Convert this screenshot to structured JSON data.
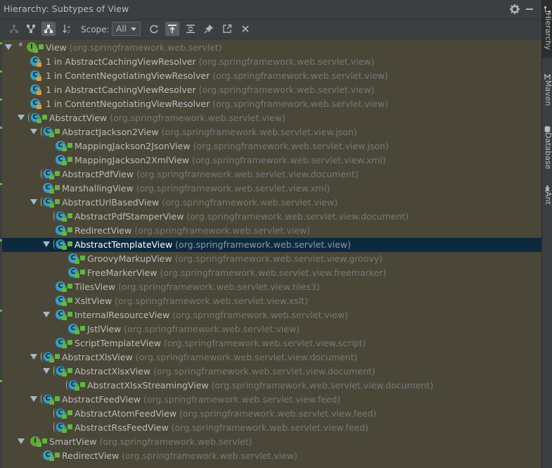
{
  "window": {
    "title": "Hierarchy:  Subtypes of View"
  },
  "toolbar": {
    "scope_label": "Scope:",
    "scope_value": "All",
    "buttons": [
      {
        "name": "supertypes-hierarchy",
        "icon": "supertypes-icon",
        "active": false
      },
      {
        "name": "subtypes-hierarchy",
        "icon": "subtypes-icon",
        "active": false
      },
      {
        "name": "class-hierarchy",
        "icon": "class-hierarchy-icon",
        "active": true
      },
      {
        "name": "sort-alphabetically",
        "icon": "sort-alpha-icon",
        "active": false
      },
      {
        "name": "refresh",
        "icon": "refresh-icon",
        "active": false
      },
      {
        "name": "autoscroll-to-source",
        "icon": "autoscroll-icon",
        "active": true
      },
      {
        "name": "expand-all",
        "icon": "expand-all-icon",
        "active": false
      },
      {
        "name": "pin",
        "icon": "pin-icon",
        "active": false
      },
      {
        "name": "export",
        "icon": "export-icon",
        "active": false
      },
      {
        "name": "close",
        "icon": "close-icon",
        "active": false
      }
    ]
  },
  "tree": [
    {
      "name": "View",
      "pkg": "(org.springframework.web.servlet)",
      "depth": 0,
      "expand": true,
      "kind": "interface",
      "star": true
    },
    {
      "name": "1 in AbstractCachingViewResolver",
      "pkg": "(org.springframework.web.servlet.view)",
      "depth": 1,
      "expand": false,
      "kind": "anon"
    },
    {
      "name": "1 in ContentNegotiatingViewResolver",
      "pkg": "(org.springframework.web.servlet.view)",
      "depth": 1,
      "expand": false,
      "kind": "anon"
    },
    {
      "name": "1 in AbstractCachingViewResolver",
      "pkg": "(org.springframework.web.servlet.view)",
      "depth": 1,
      "expand": false,
      "kind": "anon"
    },
    {
      "name": "1 in ContentNegotiatingViewResolver",
      "pkg": "(org.springframework.web.servlet.view)",
      "depth": 1,
      "expand": false,
      "kind": "anon"
    },
    {
      "name": "AbstractView",
      "pkg": "(org.springframework.web.servlet.view)",
      "depth": 1,
      "expand": true,
      "kind": "abstract"
    },
    {
      "name": "AbstractJackson2View",
      "pkg": "(org.springframework.web.servlet.view.json)",
      "depth": 2,
      "expand": true,
      "kind": "abstract"
    },
    {
      "name": "MappingJackson2JsonView",
      "pkg": "(org.springframework.web.servlet.view.json)",
      "depth": 3,
      "expand": false,
      "kind": "class"
    },
    {
      "name": "MappingJackson2XmlView",
      "pkg": "(org.springframework.web.servlet.view.xml)",
      "depth": 3,
      "expand": false,
      "kind": "class"
    },
    {
      "name": "AbstractPdfView",
      "pkg": "(org.springframework.web.servlet.view.document)",
      "depth": 2,
      "expand": false,
      "kind": "abstract"
    },
    {
      "name": "MarshallingView",
      "pkg": "(org.springframework.web.servlet.view.xml)",
      "depth": 2,
      "expand": false,
      "kind": "class"
    },
    {
      "name": "AbstractUrlBasedView",
      "pkg": "(org.springframework.web.servlet.view)",
      "depth": 2,
      "expand": true,
      "kind": "abstract"
    },
    {
      "name": "AbstractPdfStamperView",
      "pkg": "(org.springframework.web.servlet.view.document)",
      "depth": 3,
      "expand": false,
      "kind": "abstract"
    },
    {
      "name": "RedirectView",
      "pkg": "(org.springframework.web.servlet.view)",
      "depth": 3,
      "expand": false,
      "kind": "class"
    },
    {
      "name": "AbstractTemplateView",
      "pkg": "(org.springframework.web.servlet.view)",
      "depth": 3,
      "expand": true,
      "kind": "abstract",
      "selected": true
    },
    {
      "name": "GroovyMarkupView",
      "pkg": "(org.springframework.web.servlet.view.groovy)",
      "depth": 4,
      "expand": false,
      "kind": "class"
    },
    {
      "name": "FreeMarkerView",
      "pkg": "(org.springframework.web.servlet.view.freemarker)",
      "depth": 4,
      "expand": false,
      "kind": "class"
    },
    {
      "name": "TilesView",
      "pkg": "(org.springframework.web.servlet.view.tiles3)",
      "depth": 3,
      "expand": false,
      "kind": "class"
    },
    {
      "name": "XsltView",
      "pkg": "(org.springframework.web.servlet.view.xslt)",
      "depth": 3,
      "expand": false,
      "kind": "class"
    },
    {
      "name": "InternalResourceView",
      "pkg": "(org.springframework.web.servlet.view)",
      "depth": 3,
      "expand": true,
      "kind": "class"
    },
    {
      "name": "JstlView",
      "pkg": "(org.springframework.web.servlet.view)",
      "depth": 4,
      "expand": false,
      "kind": "class"
    },
    {
      "name": "ScriptTemplateView",
      "pkg": "(org.springframework.web.servlet.view.script)",
      "depth": 3,
      "expand": false,
      "kind": "class"
    },
    {
      "name": "AbstractXlsView",
      "pkg": "(org.springframework.web.servlet.view.document)",
      "depth": 2,
      "expand": true,
      "kind": "abstract"
    },
    {
      "name": "AbstractXlsxView",
      "pkg": "(org.springframework.web.servlet.view.document)",
      "depth": 3,
      "expand": true,
      "kind": "abstract"
    },
    {
      "name": "AbstractXlsxStreamingView",
      "pkg": "(org.springframework.web.servlet.view.document)",
      "depth": 4,
      "expand": false,
      "kind": "abstract"
    },
    {
      "name": "AbstractFeedView",
      "pkg": "(org.springframework.web.servlet.view.feed)",
      "depth": 2,
      "expand": true,
      "kind": "abstract"
    },
    {
      "name": "AbstractAtomFeedView",
      "pkg": "(org.springframework.web.servlet.view.feed)",
      "depth": 3,
      "expand": false,
      "kind": "abstract"
    },
    {
      "name": "AbstractRssFeedView",
      "pkg": "(org.springframework.web.servlet.view.feed)",
      "depth": 3,
      "expand": false,
      "kind": "abstract"
    },
    {
      "name": "SmartView",
      "pkg": "(org.springframework.web.servlet)",
      "depth": 1,
      "expand": true,
      "kind": "interface"
    },
    {
      "name": "RedirectView",
      "pkg": "(org.springframework.web.servlet.view)",
      "depth": 2,
      "expand": false,
      "kind": "class"
    }
  ],
  "sidebar": {
    "tabs": [
      {
        "label": "Hierarchy",
        "icon": "hierarchy-icon",
        "active": true
      },
      {
        "label": "Maven",
        "icon": "maven-icon",
        "active": false
      },
      {
        "label": "Database",
        "icon": "database-icon",
        "active": false
      },
      {
        "label": "Ant",
        "icon": "ant-icon",
        "active": false
      }
    ]
  },
  "colors": {
    "tree_bg": "#4a4739",
    "selection": "#0d293e",
    "class_icon": "#3c9dbe",
    "interface_icon": "#62a33b",
    "text": "#bbbbbb",
    "package_text": "#787878"
  }
}
